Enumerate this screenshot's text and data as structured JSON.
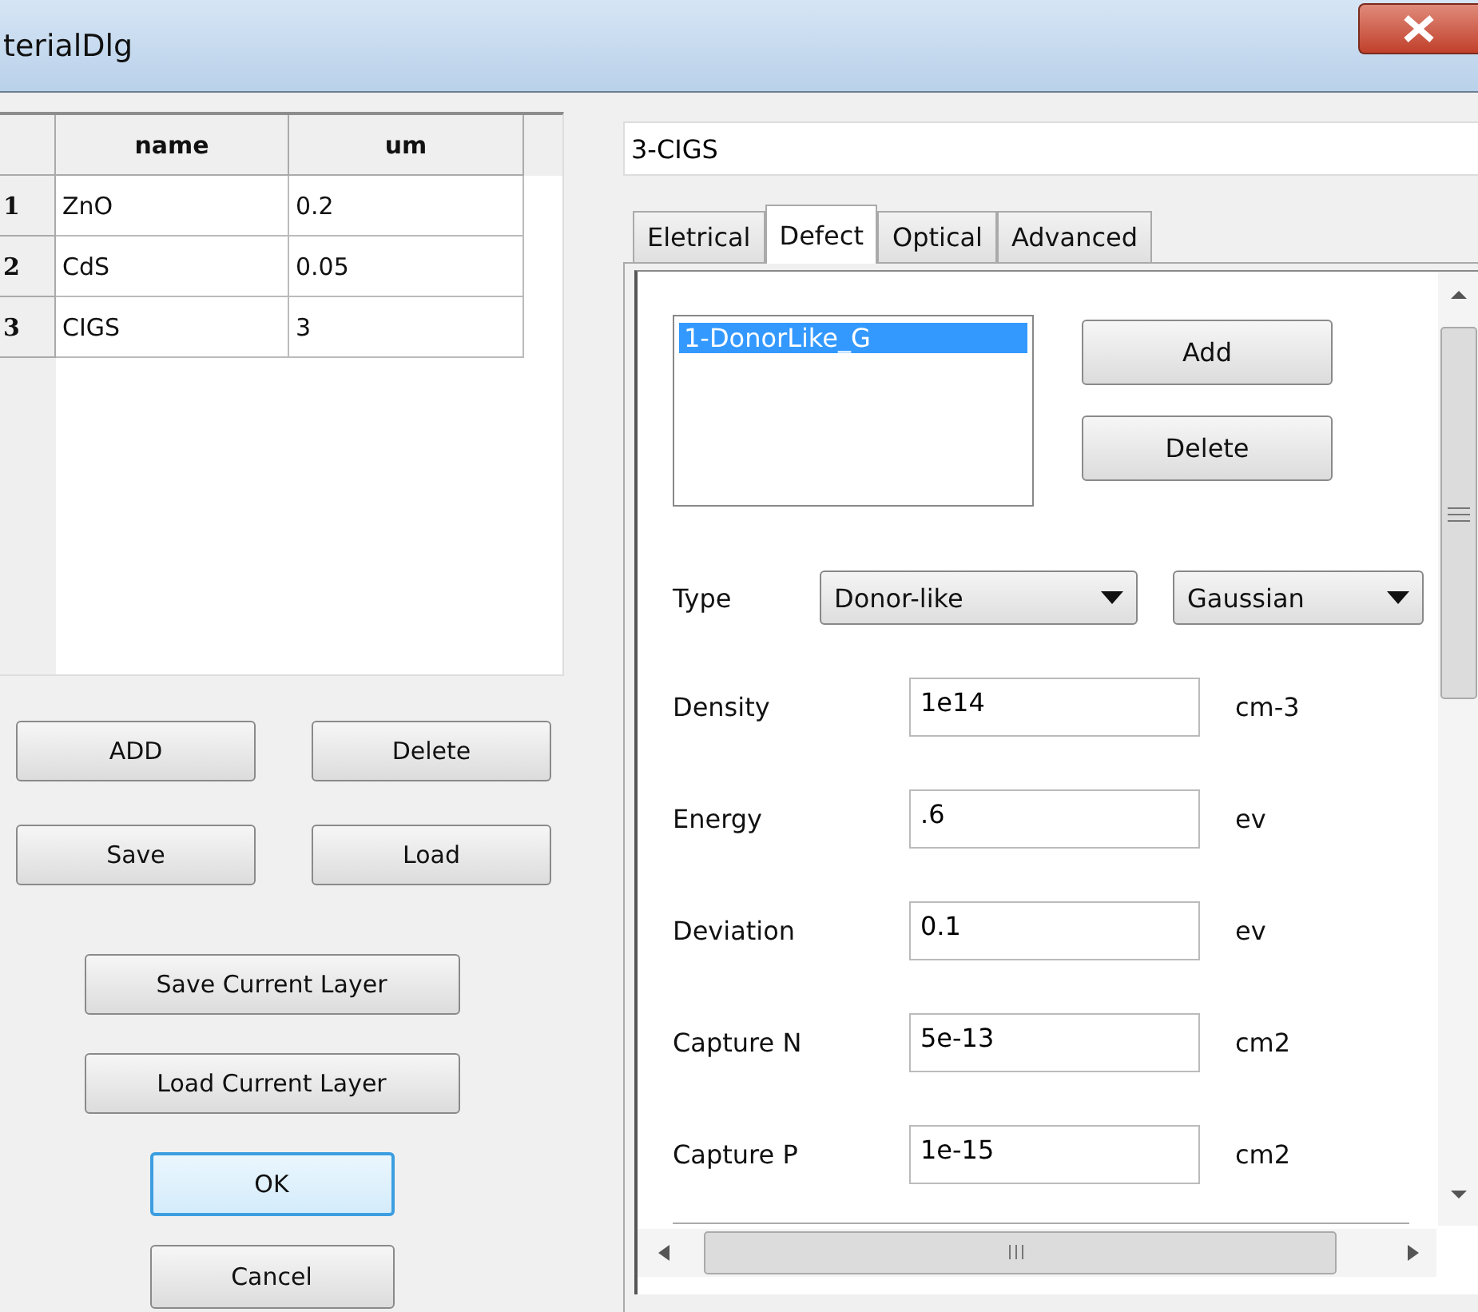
{
  "window": {
    "title": "terialDlg"
  },
  "layers_table": {
    "columns": [
      "name",
      "um"
    ],
    "rows": [
      {
        "index": "1",
        "name": "ZnO",
        "um": "0.2"
      },
      {
        "index": "2",
        "name": "CdS",
        "um": "0.05"
      },
      {
        "index": "3",
        "name": "CIGS",
        "um": "3"
      }
    ]
  },
  "left_buttons": [
    [
      {
        "label": "ADD",
        "focused": false
      },
      {
        "label": "Delete",
        "focused": false
      }
    ],
    [
      {
        "label": "Save",
        "focused": false
      },
      {
        "label": "Load",
        "focused": false
      }
    ],
    [
      {
        "label": "Save Current Layer",
        "focused": false
      }
    ],
    [
      {
        "label": "Load Current Layer",
        "focused": false
      }
    ],
    [
      {
        "label": "OK",
        "focused": true
      }
    ],
    [
      {
        "label": "Cancel",
        "focused": false
      }
    ]
  ],
  "layer_name": {
    "value": "3-CIGS"
  },
  "tabs": [
    {
      "label": "Eletrical",
      "selected": false
    },
    {
      "label": "Defect",
      "selected": true
    },
    {
      "label": "Optical",
      "selected": false
    },
    {
      "label": "Advanced",
      "selected": false
    }
  ],
  "defects": [
    {
      "label": "1-DonorLike_G",
      "selected": true
    }
  ],
  "defect_buttons": [
    "Add",
    "Delete"
  ],
  "type_row": {
    "label": "Type",
    "selects": [
      "Donor-like",
      "Gaussian"
    ]
  },
  "fields": [
    {
      "label": "Density",
      "value": "1e14",
      "unit": "cm-3"
    },
    {
      "label": "Energy",
      "value": ".6",
      "unit": "ev"
    },
    {
      "label": "Deviation",
      "value": "0.1",
      "unit": "ev"
    },
    {
      "label": "Capture N",
      "value": "5e-13",
      "unit": "cm2"
    },
    {
      "label": "Capture P",
      "value": "1e-15",
      "unit": "cm2"
    }
  ]
}
